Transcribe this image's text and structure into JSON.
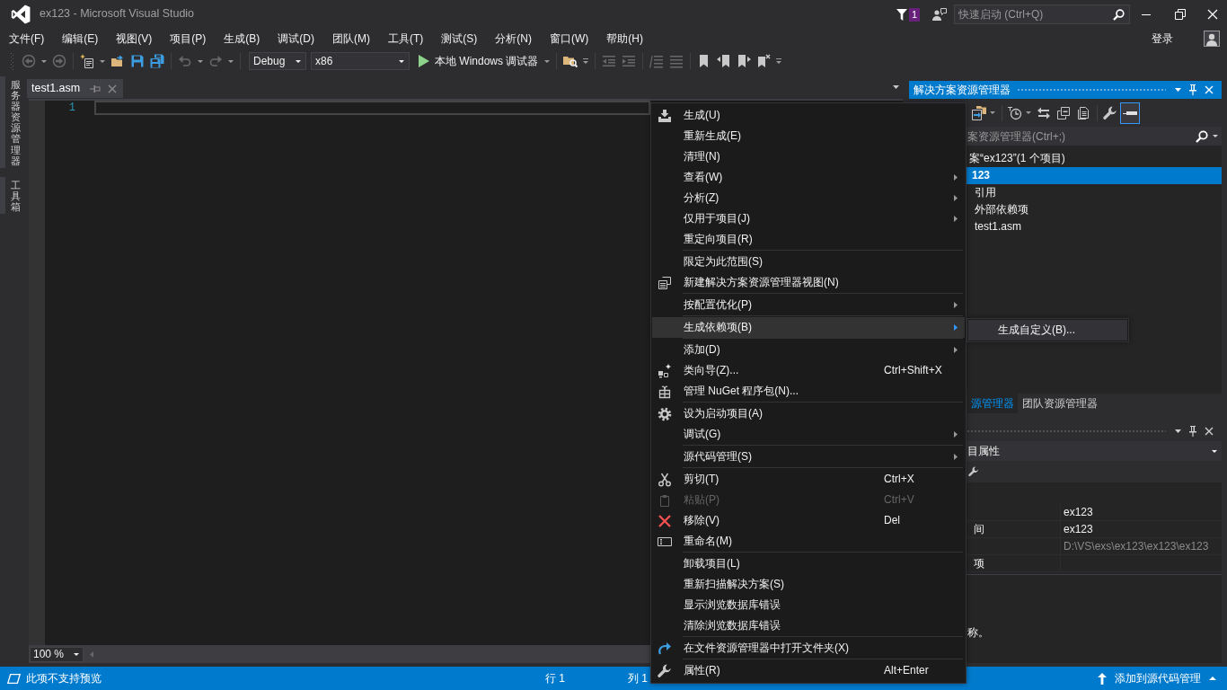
{
  "window": {
    "title": "ex123 - Microsoft Visual Studio",
    "notification_count": "1",
    "quick_launch": {
      "placeholder": "快速启动 (Ctrl+Q)"
    }
  },
  "menu_bar": {
    "items": [
      "文件(F)",
      "编辑(E)",
      "视图(V)",
      "项目(P)",
      "生成(B)",
      "调试(D)",
      "团队(M)",
      "工具(T)",
      "测试(S)",
      "分析(N)",
      "窗口(W)",
      "帮助(H)"
    ],
    "sign_in": "登录"
  },
  "toolbar": {
    "buttons": [
      {
        "disabled": true
      },
      {
        "disabled": true
      },
      {
        "disabled": false
      },
      {
        "disabled": false
      },
      {
        "disabled": false
      },
      {
        "disabled": false
      },
      {
        "disabled": true
      },
      {
        "disabled": true
      },
      {
        "disabled": false
      },
      {
        "disabled": true
      },
      {
        "disabled": true
      },
      {
        "disabled": true
      },
      {
        "disabled": true
      },
      {
        "disabled": false
      },
      {
        "disabled": false
      },
      {
        "disabled": false
      },
      {
        "disabled": false
      }
    ],
    "configuration": "Debug",
    "platform": "x86",
    "run_target": "本地 Windows 调试器"
  },
  "side_tabs": [
    "服务器资源管理器",
    "工具箱"
  ],
  "editor": {
    "tabs": [
      {
        "label": "test1.asm",
        "selected": true
      }
    ],
    "line_numbers": [
      "1"
    ],
    "zoom": "100 %"
  },
  "solution_explorer": {
    "title": "解决方案资源管理器",
    "toolbar_toggle": {
      "checked": true
    },
    "search": {
      "placeholder": "案资源管理器(Ctrl+;)"
    },
    "tree": [
      {
        "label": "案“ex123”(1 个项目)",
        "selected": false,
        "startup": false,
        "children": [
          {
            "label": "123",
            "selected": true,
            "startup": true,
            "children": [
              {
                "label": "引用",
                "selected": false,
                "startup": false
              },
              {
                "label": "外部依赖项",
                "selected": false,
                "startup": false
              },
              {
                "label": "test1.asm",
                "selected": false,
                "startup": false
              }
            ]
          }
        ]
      }
    ],
    "tabs": [
      {
        "label": "源管理器",
        "selected": true
      },
      {
        "label": "团队资源管理器",
        "selected": false
      }
    ]
  },
  "properties": {
    "selector": "目属性",
    "rows": [
      {
        "value": "ex123",
        "readonly": false
      },
      {
        "name": "间",
        "value": "ex123",
        "readonly": false
      },
      {
        "value": "D:\\VS\\exs\\ex123\\ex123\\ex123",
        "readonly": true
      },
      {
        "name": "项",
        "readonly": false
      }
    ],
    "description": "称。"
  },
  "context_menu": {
    "groups": [
      [
        {
          "label": "生成(U)",
          "has_submenu": false,
          "selected": false,
          "disabled": false
        },
        {
          "label": "重新生成(E)",
          "has_submenu": false,
          "selected": false,
          "disabled": false
        },
        {
          "label": "清理(N)",
          "has_submenu": false,
          "selected": false,
          "disabled": false
        },
        {
          "label": "查看(W)",
          "has_submenu": true,
          "selected": false,
          "disabled": false
        },
        {
          "label": "分析(Z)",
          "has_submenu": true,
          "selected": false,
          "disabled": false
        },
        {
          "label": "仅用于项目(J)",
          "has_submenu": true,
          "selected": false,
          "disabled": false
        },
        {
          "label": "重定向项目(R)",
          "has_submenu": false,
          "selected": false,
          "disabled": false
        }
      ],
      [
        {
          "label": "限定为此范围(S)",
          "has_submenu": false,
          "selected": false,
          "disabled": false
        },
        {
          "label": "新建解决方案资源管理器视图(N)",
          "has_submenu": false,
          "selected": false,
          "disabled": false
        }
      ],
      [
        {
          "label": "按配置优化(P)",
          "has_submenu": true,
          "selected": false,
          "disabled": false
        }
      ],
      [
        {
          "label": "生成依赖项(B)",
          "has_submenu": true,
          "selected": true,
          "disabled": false,
          "submenu_items": [
            {
              "label": "生成自定义(B)...",
              "selected": true
            }
          ]
        }
      ],
      [
        {
          "label": "添加(D)",
          "has_submenu": true,
          "selected": false,
          "disabled": false
        },
        {
          "label": "类向导(Z)...",
          "shortcut": "Ctrl+Shift+X",
          "has_submenu": false,
          "selected": false,
          "disabled": false
        },
        {
          "label": "管理 NuGet 程序包(N)...",
          "has_submenu": false,
          "selected": false,
          "disabled": false
        }
      ],
      [
        {
          "label": "设为启动项目(A)",
          "has_submenu": false,
          "selected": false,
          "disabled": false
        },
        {
          "label": "调试(G)",
          "has_submenu": true,
          "selected": false,
          "disabled": false
        }
      ],
      [
        {
          "label": "源代码管理(S)",
          "has_submenu": true,
          "selected": false,
          "disabled": false
        }
      ],
      [
        {
          "label": "剪切(T)",
          "shortcut": "Ctrl+X",
          "has_submenu": false,
          "selected": false,
          "disabled": false
        },
        {
          "label": "粘贴(P)",
          "shortcut": "Ctrl+V",
          "has_submenu": false,
          "selected": false,
          "disabled": true
        },
        {
          "label": "移除(V)",
          "shortcut": "Del",
          "has_submenu": false,
          "selected": false,
          "disabled": false
        },
        {
          "label": "重命名(M)",
          "has_submenu": false,
          "selected": false,
          "disabled": false
        }
      ],
      [
        {
          "label": "卸载项目(L)",
          "has_submenu": false,
          "selected": false,
          "disabled": false
        },
        {
          "label": "重新扫描解决方案(S)",
          "has_submenu": false,
          "selected": false,
          "disabled": false
        },
        {
          "label": "显示浏览数据库错误",
          "has_submenu": false,
          "selected": false,
          "disabled": false
        },
        {
          "label": "清除浏览数据库错误",
          "has_submenu": false,
          "selected": false,
          "disabled": false
        }
      ],
      [
        {
          "label": "在文件资源管理器中打开文件夹(X)",
          "has_submenu": false,
          "selected": false,
          "disabled": false
        }
      ],
      [
        {
          "label": "属性(R)",
          "shortcut": "Alt+Enter",
          "has_submenu": false,
          "selected": false,
          "disabled": false
        }
      ]
    ]
  },
  "status_bar": {
    "message": "此项不支持预览",
    "line": "行 1",
    "column": "列 1",
    "source_control": "添加到源代码管理"
  }
}
